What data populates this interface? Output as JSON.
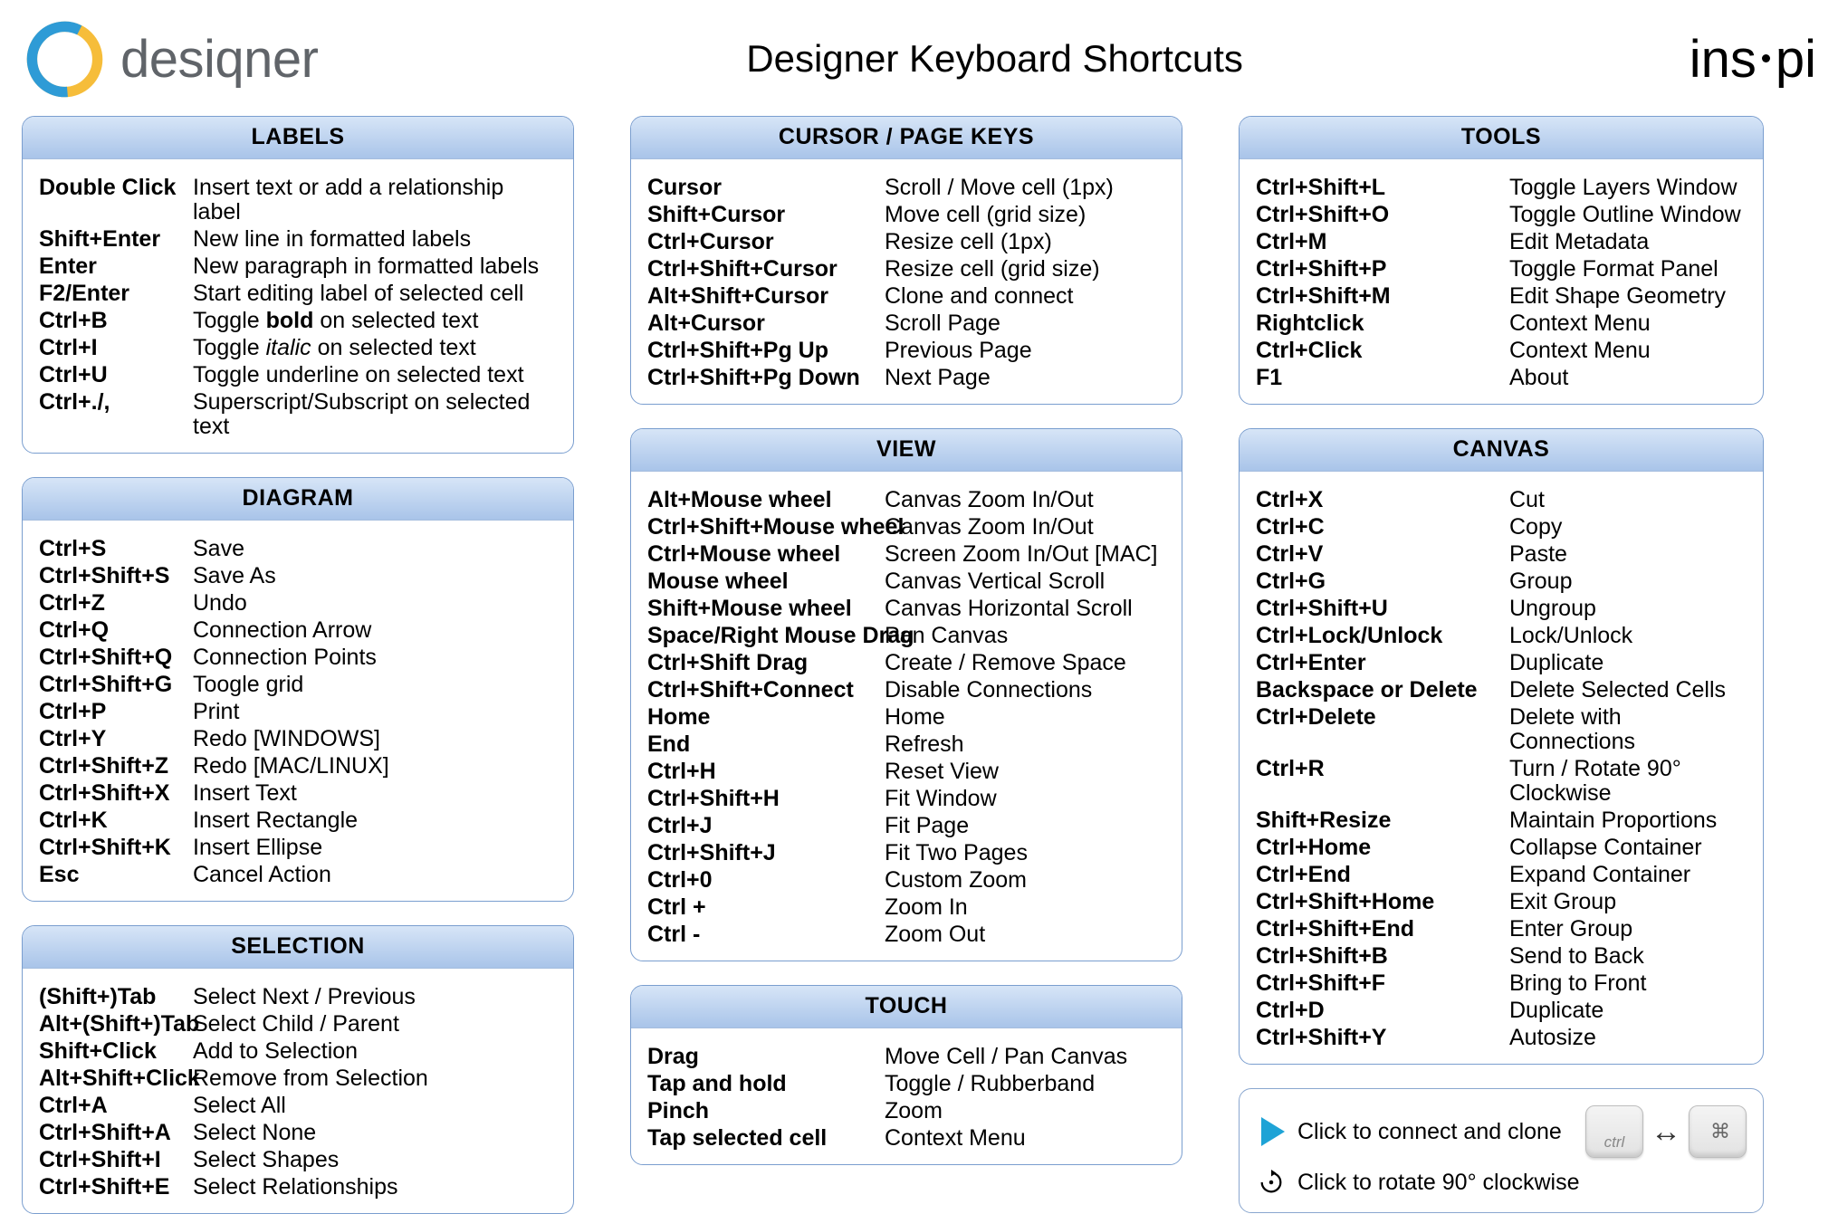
{
  "header": {
    "left_wordmark": "desiqner",
    "title": "Designer Keyboard Shortcuts",
    "right_wordmark_a": "ins",
    "right_wordmark_b": "pi"
  },
  "panels": {
    "labels": {
      "title": "LABELS",
      "rows": [
        {
          "k": "Double Click",
          "d": "Insert text or add a relationship label"
        },
        {
          "k": "Shift+Enter",
          "d": "New line in formatted labels"
        },
        {
          "k": "Enter",
          "d": "New paragraph in formatted labels"
        },
        {
          "k": "F2/Enter",
          "d": "Start editing label of selected cell"
        },
        {
          "k": "Ctrl+B",
          "d_pre": "Toggle ",
          "d_em": "bold",
          "d_post": " on selected text",
          "em_class": "bold"
        },
        {
          "k": "Ctrl+I",
          "d_pre": "Toggle ",
          "d_em": "italic",
          "d_post": " on selected text",
          "em_class": "italic"
        },
        {
          "k": "Ctrl+U",
          "d": "Toggle underline on selected text"
        },
        {
          "k": "Ctrl+./,",
          "d": "Superscript/Subscript on selected text"
        }
      ]
    },
    "diagram": {
      "title": "DIAGRAM",
      "rows": [
        {
          "k": "Ctrl+S",
          "d": "Save"
        },
        {
          "k": "Ctrl+Shift+S",
          "d": "Save As"
        },
        {
          "k": "Ctrl+Z",
          "d": "Undo"
        },
        {
          "k": "Ctrl+Q",
          "d": "Connection Arrow"
        },
        {
          "k": "Ctrl+Shift+Q",
          "d": "Connection Points"
        },
        {
          "k": "Ctrl+Shift+G",
          "d": "Toogle grid"
        },
        {
          "k": "Ctrl+P",
          "d": "Print"
        },
        {
          "k": "Ctrl+Y",
          "d": "Redo [WINDOWS]"
        },
        {
          "k": "Ctrl+Shift+Z",
          "d": "Redo [MAC/LINUX]"
        },
        {
          "k": "Ctrl+Shift+X",
          "d": "Insert Text"
        },
        {
          "k": "Ctrl+K",
          "d": "Insert Rectangle"
        },
        {
          "k": "Ctrl+Shift+K",
          "d": "Insert Ellipse"
        },
        {
          "k": "Esc",
          "d": "Cancel Action"
        }
      ]
    },
    "selection": {
      "title": "SELECTION",
      "rows": [
        {
          "k": "(Shift+)Tab",
          "d": "Select Next / Previous"
        },
        {
          "k": "Alt+(Shift+)Tab",
          "d": "Select Child / Parent"
        },
        {
          "k": "Shift+Click",
          "d": "Add to Selection"
        },
        {
          "k": "Alt+Shift+Click",
          "d": "Remove from Selection"
        },
        {
          "k": "Ctrl+A",
          "d": "Select All"
        },
        {
          "k": "Ctrl+Shift+A",
          "d": "Select None"
        },
        {
          "k": "Ctrl+Shift+I",
          "d": "Select Shapes"
        },
        {
          "k": "Ctrl+Shift+E",
          "d": "Select Relationships"
        }
      ]
    },
    "cursor": {
      "title": "CURSOR / PAGE KEYS",
      "rows": [
        {
          "k": "Cursor",
          "d": "Scroll / Move cell (1px)"
        },
        {
          "k": "Shift+Cursor",
          "d": "Move cell (grid size)"
        },
        {
          "k": "Ctrl+Cursor",
          "d": "Resize cell (1px)"
        },
        {
          "k": "Ctrl+Shift+Cursor",
          "d": "Resize cell (grid size)"
        },
        {
          "k": "Alt+Shift+Cursor",
          "d": "Clone and connect"
        },
        {
          "k": "Alt+Cursor",
          "d": "Scroll Page"
        },
        {
          "k": "Ctrl+Shift+Pg Up",
          "d": "Previous Page"
        },
        {
          "k": "Ctrl+Shift+Pg Down",
          "d": "Next Page"
        }
      ]
    },
    "view": {
      "title": "VIEW",
      "rows": [
        {
          "k": "Alt+Mouse wheel",
          "d": "Canvas Zoom In/Out"
        },
        {
          "k": "Ctrl+Shift+Mouse wheel",
          "d": "Canvas Zoom In/Out"
        },
        {
          "k": "Ctrl+Mouse wheel",
          "d": "Screen Zoom In/Out [MAC]"
        },
        {
          "k": "Mouse wheel",
          "d": "Canvas Vertical Scroll"
        },
        {
          "k": "Shift+Mouse wheel",
          "d": "Canvas Horizontal Scroll"
        },
        {
          "k": "Space/Right Mouse Drag",
          "d": "Pan Canvas"
        },
        {
          "k": "Ctrl+Shift Drag",
          "d": "Create / Remove Space"
        },
        {
          "k": "Ctrl+Shift+Connect",
          "d": "Disable Connections"
        },
        {
          "k": "Home",
          "d": "Home"
        },
        {
          "k": "End",
          "d": "Refresh"
        },
        {
          "k": "Ctrl+H",
          "d": "Reset View"
        },
        {
          "k": "Ctrl+Shift+H",
          "d": "Fit Window"
        },
        {
          "k": "Ctrl+J",
          "d": "Fit Page"
        },
        {
          "k": "Ctrl+Shift+J",
          "d": "Fit Two Pages"
        },
        {
          "k": "Ctrl+0",
          "d": "Custom Zoom"
        },
        {
          "k": "Ctrl +",
          "d": "Zoom In"
        },
        {
          "k": "Ctrl -",
          "d": "Zoom Out"
        }
      ]
    },
    "touch": {
      "title": "TOUCH",
      "rows": [
        {
          "k": "Drag",
          "d": "Move Cell / Pan Canvas"
        },
        {
          "k": "Tap and hold",
          "d": "Toggle / Rubberband"
        },
        {
          "k": "Pinch",
          "d": "Zoom"
        },
        {
          "k": "Tap selected cell",
          "d": "Context Menu"
        }
      ]
    },
    "tools": {
      "title": "TOOLS",
      "rows": [
        {
          "k": "Ctrl+Shift+L",
          "d": "Toggle Layers Window"
        },
        {
          "k": "Ctrl+Shift+O",
          "d": "Toggle Outline Window"
        },
        {
          "k": "Ctrl+M",
          "d": "Edit Metadata"
        },
        {
          "k": "Ctrl+Shift+P",
          "d": "Toggle Format Panel"
        },
        {
          "k": "Ctrl+Shift+M",
          "d": "Edit Shape Geometry"
        },
        {
          "k": "Rightclick",
          "d": "Context Menu"
        },
        {
          "k": "Ctrl+Click",
          "d": "Context Menu"
        },
        {
          "k": "F1",
          "d": "About"
        }
      ]
    },
    "canvas": {
      "title": "CANVAS",
      "rows": [
        {
          "k": "Ctrl+X",
          "d": "Cut"
        },
        {
          "k": "Ctrl+C",
          "d": "Copy"
        },
        {
          "k": "Ctrl+V",
          "d": "Paste"
        },
        {
          "k": "Ctrl+G",
          "d": "Group"
        },
        {
          "k": "Ctrl+Shift+U",
          "d": "Ungroup"
        },
        {
          "k": "Ctrl+Lock/Unlock",
          "d": "Lock/Unlock"
        },
        {
          "k": "Ctrl+Enter",
          "d": "Duplicate"
        },
        {
          "k": "Backspace or Delete",
          "d": "Delete Selected Cells"
        },
        {
          "k": "Ctrl+Delete",
          "d": "Delete with Connections"
        },
        {
          "k": "Ctrl+R",
          "d": "Turn / Rotate 90° Clockwise"
        },
        {
          "k": "Shift+Resize",
          "d": "Maintain Proportions"
        },
        {
          "k": "Ctrl+Home",
          "d": "Collapse Container"
        },
        {
          "k": "Ctrl+End",
          "d": "Expand Container"
        },
        {
          "k": "Ctrl+Shift+Home",
          "d": "Exit Group"
        },
        {
          "k": "Ctrl+Shift+End",
          "d": "Enter Group"
        },
        {
          "k": "Ctrl+Shift+B",
          "d": "Send to Back"
        },
        {
          "k": "Ctrl+Shift+F",
          "d": "Bring to Front"
        },
        {
          "k": "Ctrl+D",
          "d": "Duplicate"
        },
        {
          "k": "Ctrl+Shift+Y",
          "d": "Autosize"
        }
      ]
    }
  },
  "hints": {
    "connect": "Click to connect and clone",
    "rotate": "Click to rotate 90° clockwise",
    "ctrl_key": "ctrl"
  }
}
